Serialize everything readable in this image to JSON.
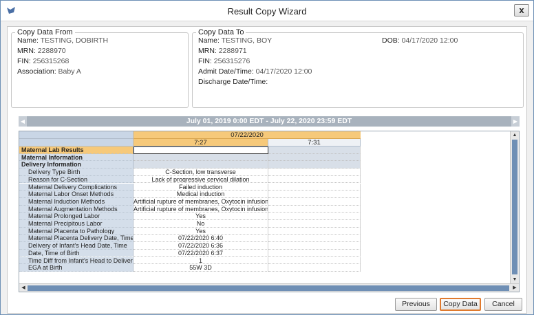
{
  "window": {
    "title": "Result Copy Wizard",
    "close_label": "x"
  },
  "copy_from": {
    "legend": "Copy Data From",
    "fields": [
      {
        "label": "Name:",
        "value": "TESTING, DOBIRTH"
      },
      {
        "label": "MRN:",
        "value": "2288970"
      },
      {
        "label": "FIN:",
        "value": "256315268"
      },
      {
        "label": "Association:",
        "value": "Baby A"
      }
    ]
  },
  "copy_to": {
    "legend": "Copy Data To",
    "fields": [
      {
        "label": "Name:",
        "value": "TESTING, BOY"
      },
      {
        "label": "MRN:",
        "value": "2288971"
      },
      {
        "label": "FIN:",
        "value": "256315276"
      },
      {
        "label": "Admit Date/Time:",
        "value": "04/17/2020 12:00"
      },
      {
        "label": "Discharge Date/Time:",
        "value": ""
      }
    ],
    "dob_label": "DOB:",
    "dob_value": "04/17/2020 12:00"
  },
  "date_range": "July 01, 2019 0:00 EDT - July 22, 2020 23:59 EDT",
  "grid": {
    "date_header": "07/22/2020",
    "times": [
      "7:27",
      "7:31"
    ],
    "rows": [
      {
        "label": "Maternal Lab Results",
        "v1": "",
        "kind": "selsect"
      },
      {
        "label": "Maternal Information",
        "v1": "",
        "kind": "sect"
      },
      {
        "label": "Delivery Information",
        "v1": "",
        "kind": "sect"
      },
      {
        "label": "Delivery Type Birth",
        "v1": "C-Section, low transverse",
        "kind": "sub"
      },
      {
        "label": "Reason for C-Section",
        "v1": "Lack of progressive cervical dilation",
        "kind": "sub"
      },
      {
        "label": "Maternal Delivery Complications",
        "v1": "Failed induction",
        "kind": "sub"
      },
      {
        "label": "Maternal Labor Onset Methods",
        "v1": "Medical induction",
        "kind": "sub"
      },
      {
        "label": "Maternal Induction Methods",
        "v1": "Artificial rupture of membranes, Oxytocin infusion",
        "kind": "sub"
      },
      {
        "label": "Maternal Augmentation Methods",
        "v1": "Artificial rupture of membranes, Oxytocin infusion",
        "kind": "sub"
      },
      {
        "label": "Maternal Prolonged Labor",
        "v1": "Yes",
        "kind": "sub"
      },
      {
        "label": "Maternal Precipitous Labor",
        "v1": "No",
        "kind": "sub"
      },
      {
        "label": "Maternal Placenta to Pathology",
        "v1": "Yes",
        "kind": "sub"
      },
      {
        "label": "Maternal Placenta Delivery Date, Time",
        "v1": "07/22/2020 6:40",
        "kind": "sub"
      },
      {
        "label": "Delivery of Infant's Head Date, Time",
        "v1": "07/22/2020 6:36",
        "kind": "sub"
      },
      {
        "label": "Date, Time of Birth",
        "v1": "07/22/2020 6:37",
        "kind": "sub"
      },
      {
        "label": "Time Diff from Infant's Head to Delivery",
        "v1": "1",
        "kind": "sub"
      },
      {
        "label": "EGA at Birth",
        "v1": "55W 3D",
        "kind": "sub"
      }
    ]
  },
  "buttons": {
    "previous": "Previous",
    "copy": "Copy Data",
    "cancel": "Cancel"
  },
  "colors": {
    "accent": "#f6c97a",
    "primary_border": "#e07a2e",
    "scroll_thumb": "#6f8fb5"
  }
}
